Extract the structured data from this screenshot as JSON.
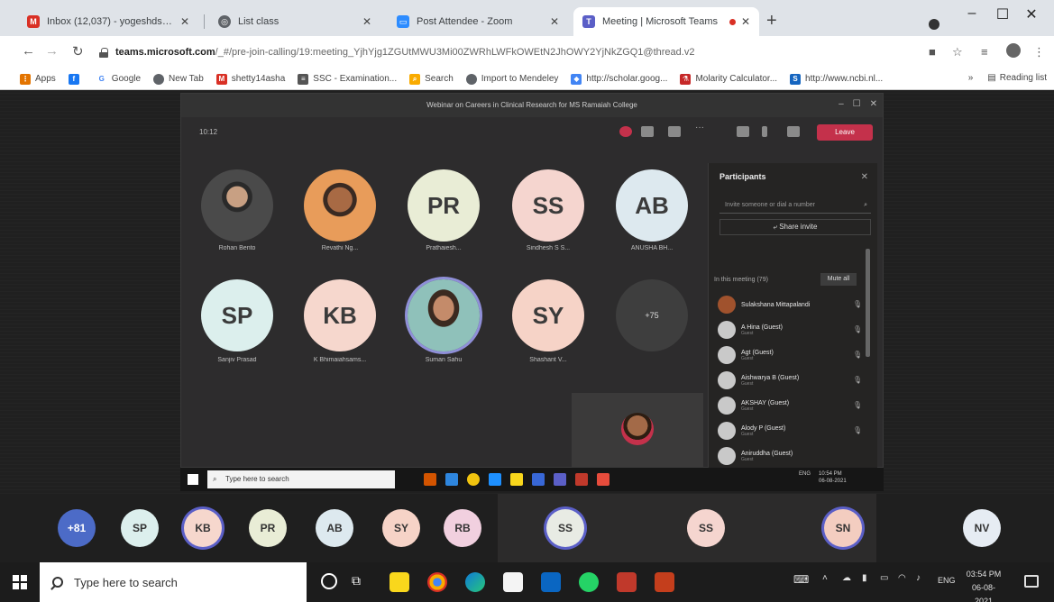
{
  "browser": {
    "tabs": [
      {
        "title": "Inbox (12,037) - yogeshdshetty@",
        "icon": "gmail-icon",
        "color": "#d93025"
      },
      {
        "title": "List class",
        "icon": "globe-icon",
        "color": "#5f6368"
      },
      {
        "title": "Post Attendee - Zoom",
        "icon": "zoom-icon",
        "color": "#2d8cff"
      },
      {
        "title": "Meeting | Microsoft Teams",
        "icon": "teams-icon",
        "color": "#5b5fc7"
      }
    ],
    "url_host": "teams.microsoft.com",
    "url_rest": "/_#/pre-join-calling/19:meeting_YjhYjg1ZGUtMWU3Mi00ZWRhLWFkOWEtN2JhOWY2YjNkZGQ1@thread.v2",
    "bookmarks": [
      "Apps",
      "Google",
      "New Tab",
      "shetty14asha",
      "SSC - Examination...",
      "Search",
      "Import to Mendeley",
      "http://scholar.goog...",
      "Molarity Calculator...",
      "http://www.ncbi.nl..."
    ],
    "reading_list": "Reading list"
  },
  "meeting": {
    "title": "Webinar on Careers in Clinical Research for MS Ramaiah College",
    "timer": "10:12",
    "leave_label": "Leave",
    "tiles_row1": [
      {
        "initials": "",
        "name": "Rohan Bento",
        "bg": "#6a6a6a",
        "photo": true
      },
      {
        "initials": "",
        "name": "Revathi Ng...",
        "bg": "#d98e5a",
        "photo": true
      },
      {
        "initials": "PR",
        "name": "Prathaiesh...",
        "bg": "#e9edd6"
      },
      {
        "initials": "SS",
        "name": "Sindhesh S S...",
        "bg": "#f5d5cf"
      },
      {
        "initials": "AB",
        "name": "ANUSHA BH...",
        "bg": "#dde9ef"
      }
    ],
    "tiles_row2": [
      {
        "initials": "SP",
        "name": "Sanjiv Prasad",
        "bg": "#dcefed"
      },
      {
        "initials": "KB",
        "name": "K Bhimaiahsams...",
        "bg": "#f6d7cd"
      },
      {
        "initials": "",
        "name": "Suman Sahu",
        "bg": "#8fc1ba",
        "photo": true
      },
      {
        "initials": "SY",
        "name": "Shashant V...",
        "bg": "#f6d3c7"
      },
      {
        "initials": "+75",
        "name": "",
        "bg": "#3e3e3e"
      }
    ]
  },
  "participants": {
    "title": "Participants",
    "search_placeholder": "Invite someone or dial a number",
    "share_invite": "Share invite",
    "section": "In this meeting (79)",
    "mute_all": "Mute all",
    "list": [
      {
        "name": "Sulakshana Mittapalandi",
        "guest": ""
      },
      {
        "name": "A Hina (Guest)",
        "guest": "Guest"
      },
      {
        "name": "Agt (Guest)",
        "guest": "Guest"
      },
      {
        "name": "Aishwarya B (Guest)",
        "guest": "Guest"
      },
      {
        "name": "AKSHAY (Guest)",
        "guest": "Guest"
      },
      {
        "name": "Alody P (Guest)",
        "guest": "Guest"
      },
      {
        "name": "Aniruddha (Guest)",
        "guest": "Guest"
      }
    ]
  },
  "inner_taskbar": {
    "search": "Type here to search",
    "lang": "ENG",
    "time": "10:54 PM",
    "date": "06-08-2021"
  },
  "strip": [
    {
      "initials": "+81",
      "bg": "#4c6bc7",
      "fg": "#ffffff"
    },
    {
      "initials": "SP",
      "bg": "#dcefed",
      "fg": "#333333"
    },
    {
      "initials": "KB",
      "bg": "#f6d7cd",
      "fg": "#333333",
      "ring": true
    },
    {
      "initials": "PR",
      "bg": "#e9edd6",
      "fg": "#333333"
    },
    {
      "initials": "AB",
      "bg": "#dde9ef",
      "fg": "#333333"
    },
    {
      "initials": "SY",
      "bg": "#f6d3c7",
      "fg": "#333333"
    },
    {
      "initials": "RB",
      "bg": "#f1d0df",
      "fg": "#333333"
    },
    {
      "initials": "SS",
      "bg": "#e8ebe4",
      "fg": "#333333",
      "ring": true
    },
    {
      "initials": "SS",
      "bg": "#f5d5cf",
      "fg": "#333333"
    },
    {
      "initials": "SN",
      "bg": "#f3cdc0",
      "fg": "#333333",
      "ring": true
    },
    {
      "initials": "NV",
      "bg": "#e6ecf3",
      "fg": "#333333"
    }
  ],
  "taskbar": {
    "search": "Type here to search",
    "lang": "ENG",
    "time": "03:54 PM",
    "date": "06-08-2021"
  }
}
